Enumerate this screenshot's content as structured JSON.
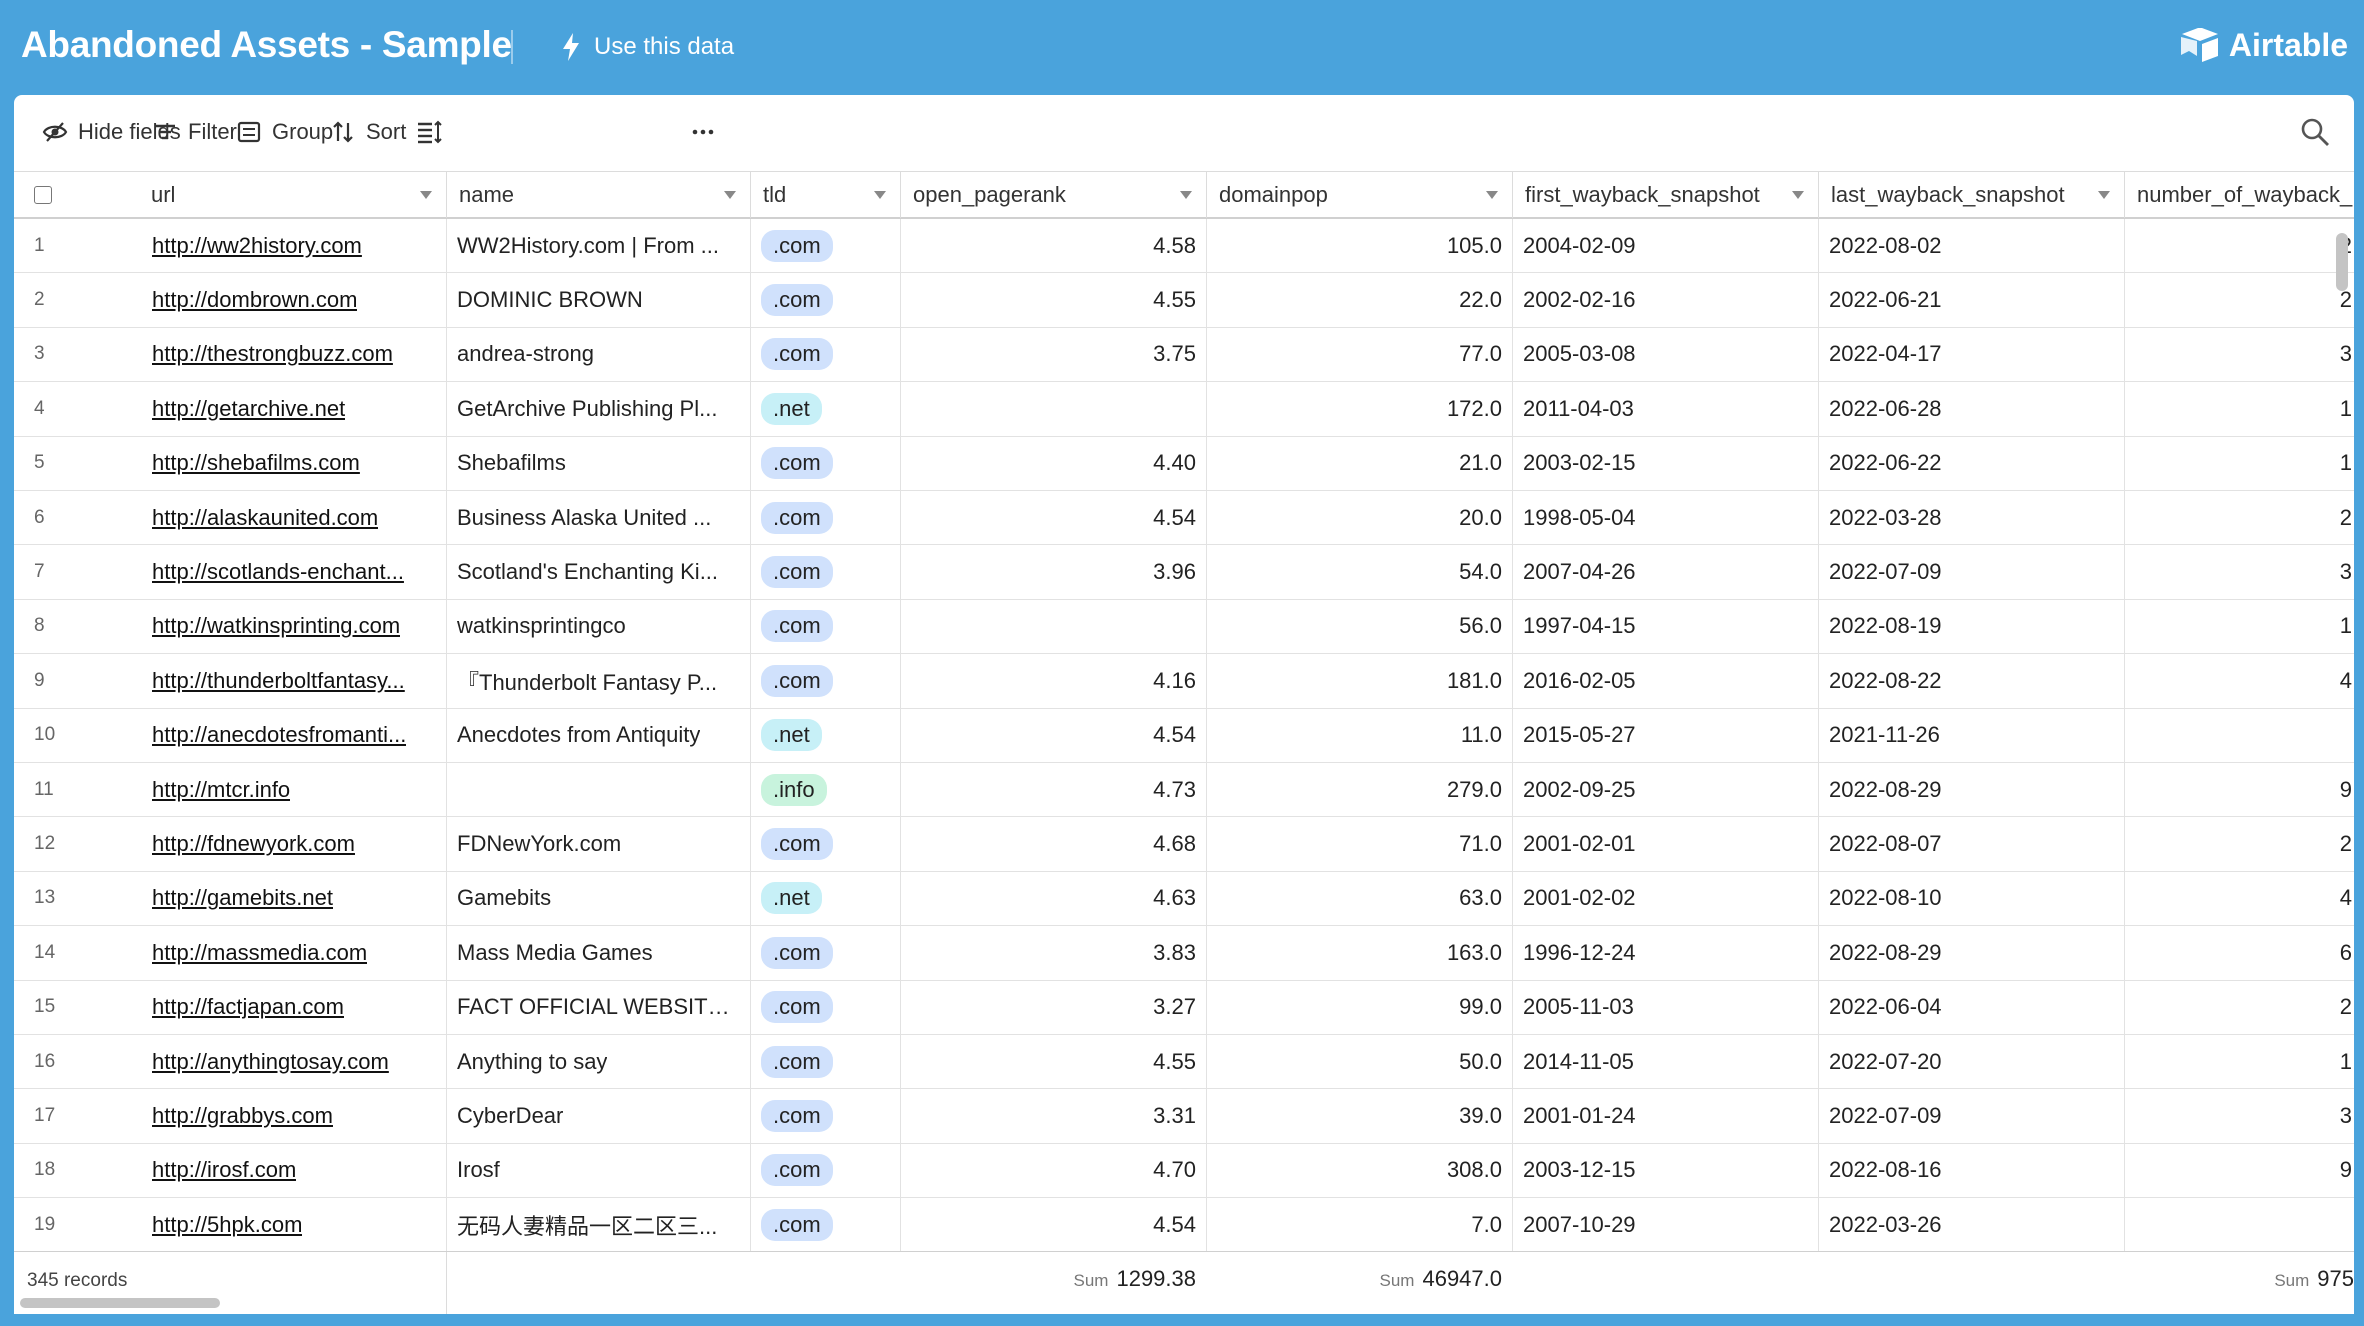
{
  "header": {
    "title": "Abandoned Assets - Sample",
    "use_data_label": "Use this data",
    "brand": "Airtable"
  },
  "toolbar": {
    "hide_fields": "Hide fields",
    "filter": "Filter",
    "group": "Group",
    "sort": "Sort"
  },
  "columns": [
    "url",
    "name",
    "tld",
    "open_pagerank",
    "domainpop",
    "first_wayback_snapshot",
    "last_wayback_snapshot",
    "number_of_wayback_"
  ],
  "rows": [
    {
      "n": "1",
      "url": "http://ww2history.com",
      "name": "WW2History.com | From ...",
      "tld": ".com",
      "pr": "4.58",
      "dp": "105.0",
      "first": "2004-02-09",
      "last": "2022-08-02",
      "nw": "2"
    },
    {
      "n": "2",
      "url": "http://dombrown.com",
      "name": "DOMINIC BROWN",
      "tld": ".com",
      "pr": "4.55",
      "dp": "22.0",
      "first": "2002-02-16",
      "last": "2022-06-21",
      "nw": "2"
    },
    {
      "n": "3",
      "url": "http://thestrongbuzz.com",
      "name": "andrea-strong",
      "tld": ".com",
      "pr": "3.75",
      "dp": "77.0",
      "first": "2005-03-08",
      "last": "2022-04-17",
      "nw": "3"
    },
    {
      "n": "4",
      "url": "http://getarchive.net",
      "name": "GetArchive Publishing Pl...",
      "tld": ".net",
      "pr": "",
      "dp": "172.0",
      "first": "2011-04-03",
      "last": "2022-06-28",
      "nw": "1"
    },
    {
      "n": "5",
      "url": "http://shebafilms.com",
      "name": "Shebafilms",
      "tld": ".com",
      "pr": "4.40",
      "dp": "21.0",
      "first": "2003-02-15",
      "last": "2022-06-22",
      "nw": "1"
    },
    {
      "n": "6",
      "url": "http://alaskaunited.com",
      "name": "Business Alaska United ...",
      "tld": ".com",
      "pr": "4.54",
      "dp": "20.0",
      "first": "1998-05-04",
      "last": "2022-03-28",
      "nw": "2"
    },
    {
      "n": "7",
      "url": "http://scotlands-enchant...",
      "name": "Scotland's Enchanting Ki...",
      "tld": ".com",
      "pr": "3.96",
      "dp": "54.0",
      "first": "2007-04-26",
      "last": "2022-07-09",
      "nw": "3"
    },
    {
      "n": "8",
      "url": "http://watkinsprinting.com",
      "name": "watkinsprintingco",
      "tld": ".com",
      "pr": "",
      "dp": "56.0",
      "first": "1997-04-15",
      "last": "2022-08-19",
      "nw": "1"
    },
    {
      "n": "9",
      "url": "http://thunderboltfantasy...",
      "name": "『Thunderbolt Fantasy P...",
      "tld": ".com",
      "pr": "4.16",
      "dp": "181.0",
      "first": "2016-02-05",
      "last": "2022-08-22",
      "nw": "4"
    },
    {
      "n": "10",
      "url": "http://anecdotesfromanti...",
      "name": "Anecdotes from Antiquity",
      "tld": ".net",
      "pr": "4.54",
      "dp": "11.0",
      "first": "2015-05-27",
      "last": "2021-11-26",
      "nw": ""
    },
    {
      "n": "11",
      "url": "http://mtcr.info",
      "name": "",
      "tld": ".info",
      "pr": "4.73",
      "dp": "279.0",
      "first": "2002-09-25",
      "last": "2022-08-29",
      "nw": "9"
    },
    {
      "n": "12",
      "url": "http://fdnewyork.com",
      "name": "FDNewYork.com",
      "tld": ".com",
      "pr": "4.68",
      "dp": "71.0",
      "first": "2001-02-01",
      "last": "2022-08-07",
      "nw": "2"
    },
    {
      "n": "13",
      "url": "http://gamebits.net",
      "name": "Gamebits",
      "tld": ".net",
      "pr": "4.63",
      "dp": "63.0",
      "first": "2001-02-02",
      "last": "2022-08-10",
      "nw": "4"
    },
    {
      "n": "14",
      "url": "http://massmedia.com",
      "name": "Mass Media Games",
      "tld": ".com",
      "pr": "3.83",
      "dp": "163.0",
      "first": "1996-12-24",
      "last": "2022-08-29",
      "nw": "6"
    },
    {
      "n": "15",
      "url": "http://factjapan.com",
      "name": "FACT OFFICIAL WEBSITE...",
      "tld": ".com",
      "pr": "3.27",
      "dp": "99.0",
      "first": "2005-11-03",
      "last": "2022-06-04",
      "nw": "2"
    },
    {
      "n": "16",
      "url": "http://anythingtosay.com",
      "name": "Anything to say",
      "tld": ".com",
      "pr": "4.55",
      "dp": "50.0",
      "first": "2014-11-05",
      "last": "2022-07-20",
      "nw": "1"
    },
    {
      "n": "17",
      "url": "http://grabbys.com",
      "name": "CyberDear",
      "tld": ".com",
      "pr": "3.31",
      "dp": "39.0",
      "first": "2001-01-24",
      "last": "2022-07-09",
      "nw": "3"
    },
    {
      "n": "18",
      "url": "http://irosf.com",
      "name": "Irosf",
      "tld": ".com",
      "pr": "4.70",
      "dp": "308.0",
      "first": "2003-12-15",
      "last": "2022-08-16",
      "nw": "9"
    },
    {
      "n": "19",
      "url": "http://5hpk.com",
      "name": "无码人妻精品一区二区三...",
      "tld": ".com",
      "pr": "4.54",
      "dp": "7.0",
      "first": "2007-10-29",
      "last": "2022-03-26",
      "nw": ""
    }
  ],
  "footer": {
    "records": "345 records",
    "sum_label": "Sum",
    "pagerank_sum": "1299.38",
    "domainpop_sum": "46947.0",
    "wayback_sum": "975"
  },
  "colors": {
    "topbar": "#4aa3dc",
    "pill_com": "#d0e1fc",
    "pill_net": "#c7f0f7",
    "pill_info": "#c8f3dd"
  }
}
